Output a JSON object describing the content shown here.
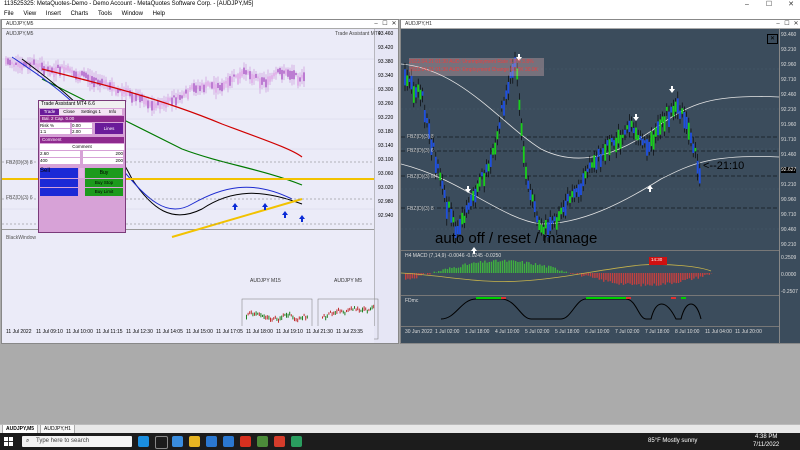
{
  "app": {
    "title": "113525325: MetaQuotes-Demo - Demo Account - MetaQuotes Software Corp. - [AUDJPY,M5]"
  },
  "window_controls": {
    "minimize": "–",
    "maximize": "☐",
    "close": "✕"
  },
  "menu": [
    "File",
    "View",
    "Insert",
    "Charts",
    "Tools",
    "Window",
    "Help"
  ],
  "left_chart": {
    "title": "AUDJPY,M5",
    "label_tr": "Trade Assistant MT4",
    "price_scale": [
      "93.460",
      "93.420",
      "93.380",
      "93.340",
      "93.300",
      "93.260",
      "93.220",
      "93.180",
      "93.140",
      "93.100",
      "93.060",
      "93.020",
      "92.980",
      "92.940"
    ],
    "time_scale": [
      "11 Jul 2022",
      "11 Jul 09:10",
      "11 Jul 10:00",
      "11 Jul 11:15",
      "11 Jul 12:30",
      "11 Jul 14:05",
      "11 Jul 15:00",
      "11 Jul 17:05",
      "11 Jul 18:00",
      "11 Jul 19:10",
      "11 Jul 21:30",
      "11 Jul 23:35"
    ],
    "indicator_label": "BlackWindow",
    "sub_labels": {
      "m15": "AUDJPY M15",
      "m5": "AUDJPY M5"
    },
    "annotation_levels": [
      "FBZ(D)(3) 8",
      "FBZ(D)(3) 6",
      "FBZ(D)(3) M4"
    ]
  },
  "trade_panel": {
    "title": "Trade Assistant MT4 6.6",
    "tabs": [
      "Trade",
      "Close",
      "Settings 1",
      "Info"
    ],
    "rows": [
      {
        "label": "Bal. 2 Cap. 0.00",
        "value": ""
      },
      {
        "label": "Risk %",
        "value": "0.00"
      },
      {
        "label": "Entry",
        "value": "Price"
      },
      {
        "label": "1:1",
        "value": "2.00"
      }
    ],
    "flip_label": "Lines",
    "comment_label": "Comment",
    "comment_value": "Comment",
    "sl_label": "2.60",
    "sl_value": "200",
    "tp_label": "400",
    "tp_value": "200",
    "buttons": {
      "sell": "Sell",
      "buy": "Buy",
      "buy_stop": "Buy Stop",
      "buy_limit": "Buy Limit",
      "sell_stop": "",
      "sell_limit": ""
    }
  },
  "right_chart": {
    "title": "AUDJPY,H1",
    "news": [
      {
        "time": "2022.04.21 01:30",
        "text": "AUD: Unemployment Rate",
        "actual": "3.9%",
        "forecast": "3.8%"
      },
      {
        "time": "2022.04.21 01:30",
        "text": "AUD: Employment Change",
        "actual": "60.7K",
        "forecast": "30.0K"
      }
    ],
    "price_scale": [
      "93.460",
      "93.210",
      "92.960",
      "92.710",
      "92.460",
      "92.210",
      "91.960",
      "91.710",
      "91.460",
      "91.210",
      "90.960",
      "90.710",
      "90.460",
      "90.210"
    ],
    "current_price": "92.627",
    "time_scale": [
      "30 Jun 2022",
      "1 Jul 02:00",
      "1 Jul 18:00",
      "4 Jul 10:00",
      "5 Jul 02:00",
      "5 Jul 18:00",
      "6 Jul 10:00",
      "7 Jul 02:00",
      "7 Jul 18:00",
      "8 Jul 10:00",
      "11 Jul 04:00",
      "11 Jul 20:00"
    ],
    "annotation_text": "auto off / reset / manage",
    "annotation_time": "<--21:10",
    "red_box": "14:30",
    "levels": [
      "FBZ(D)(3) 8",
      "FBZ(D)(3) 6",
      "FBZ(D)(3) M4",
      "FBZ(D)(3) 8"
    ],
    "macd_label": "H4 MACD (7,14,9) -0.0046 -0.0245 -0.0250",
    "macd_scale": [
      "0.2509",
      "0.0000",
      "-0.2507"
    ],
    "sub2_label": "FDmc"
  },
  "tabs": [
    "AUDJPY,M5",
    "AUDJPY,H1"
  ],
  "taskbar": {
    "search_placeholder": "Type here to search",
    "weather": "85°F  Mostly sunny",
    "time": "4:38 PM",
    "date": "7/11/2022"
  }
}
